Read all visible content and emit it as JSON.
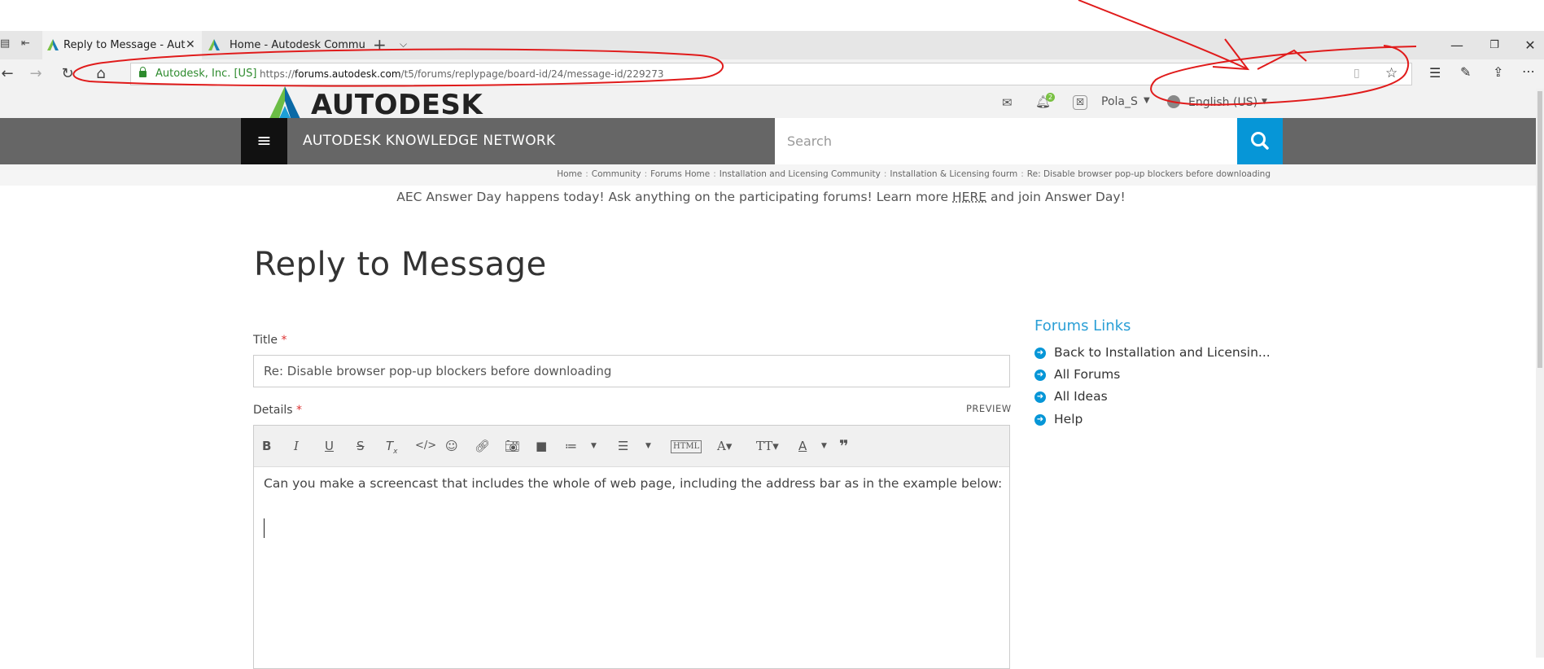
{
  "browser": {
    "tabs": [
      {
        "label": "Reply to Message - Aut",
        "active": true
      },
      {
        "label": "Home - Autodesk Commun",
        "active": false
      }
    ],
    "site_identity": "Autodesk, Inc. [US]",
    "url_prefix": "https://",
    "url_domain": "forums.autodesk.com",
    "url_path": "/t5/forums/replypage/board-id/24/message-id/229273"
  },
  "header": {
    "logo_text": "AUTODESK",
    "notification_count": "2",
    "user_name": "Pola_S",
    "language": "English (US)"
  },
  "nav": {
    "network_title": "AUTODESK KNOWLEDGE NETWORK",
    "search_placeholder": "Search"
  },
  "breadcrumb": [
    "Home",
    "Community",
    "Forums Home",
    "Installation and Licensing Community",
    "Installation & Licensing fourm",
    "Re: Disable browser pop-up blockers before downloading"
  ],
  "announcement": {
    "before": "AEC Answer Day happens today! Ask anything on the participating forums! Learn more ",
    "link": "HERE",
    "after": " and join Answer Day!"
  },
  "page": {
    "title": "Reply to Message",
    "title_label": "Title",
    "required_mark": "*",
    "title_value": "Re: Disable browser pop-up blockers before downloading",
    "details_label": "Details",
    "preview_label": "PREVIEW",
    "body_text": "Can you make a screencast that includes the whole of web page, including the address bar as in the example below:"
  },
  "sidebar": {
    "title": "Forums Links",
    "links": [
      "Back to Installation and Licensin...",
      "All Forums",
      "All Ideas",
      "Help"
    ]
  },
  "colors": {
    "accent": "#0696d7",
    "nav_band": "#666666",
    "annotation": "#e01b1b"
  }
}
